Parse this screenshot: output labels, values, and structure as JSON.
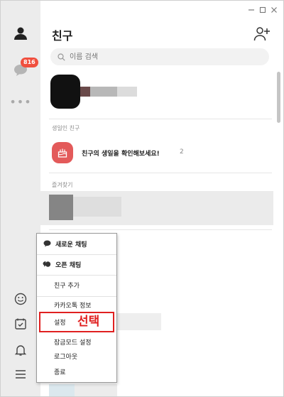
{
  "window": {
    "minimize_icon": "minimize-icon",
    "maximize_icon": "maximize-icon",
    "close_icon": "close-icon"
  },
  "sidebar": {
    "chat_badge": "816"
  },
  "header": {
    "title": "친구"
  },
  "search": {
    "placeholder": "이름 검색"
  },
  "birthday": {
    "section_label": "생일인 친구",
    "text": "친구의 생일을 확인해보세요!",
    "count": "2"
  },
  "favorites": {
    "section_label": "즐겨찾기"
  },
  "menu": {
    "new_chat": "새로운 채팅",
    "open_chat": "오픈 채팅",
    "add_friend": "친구 추가",
    "kakaotalk_info": "카카오톡 정보",
    "settings": "설정",
    "lock_mode_settings": "잠금모드 설정",
    "logout": "로그아웃",
    "quit": "종료"
  },
  "annotation": {
    "label": "선택",
    "color": "#e02020"
  },
  "colors": {
    "sidebar_bg": "#ececec",
    "badge": "#f04f3e",
    "birthday_icon": "#e35a5a"
  }
}
